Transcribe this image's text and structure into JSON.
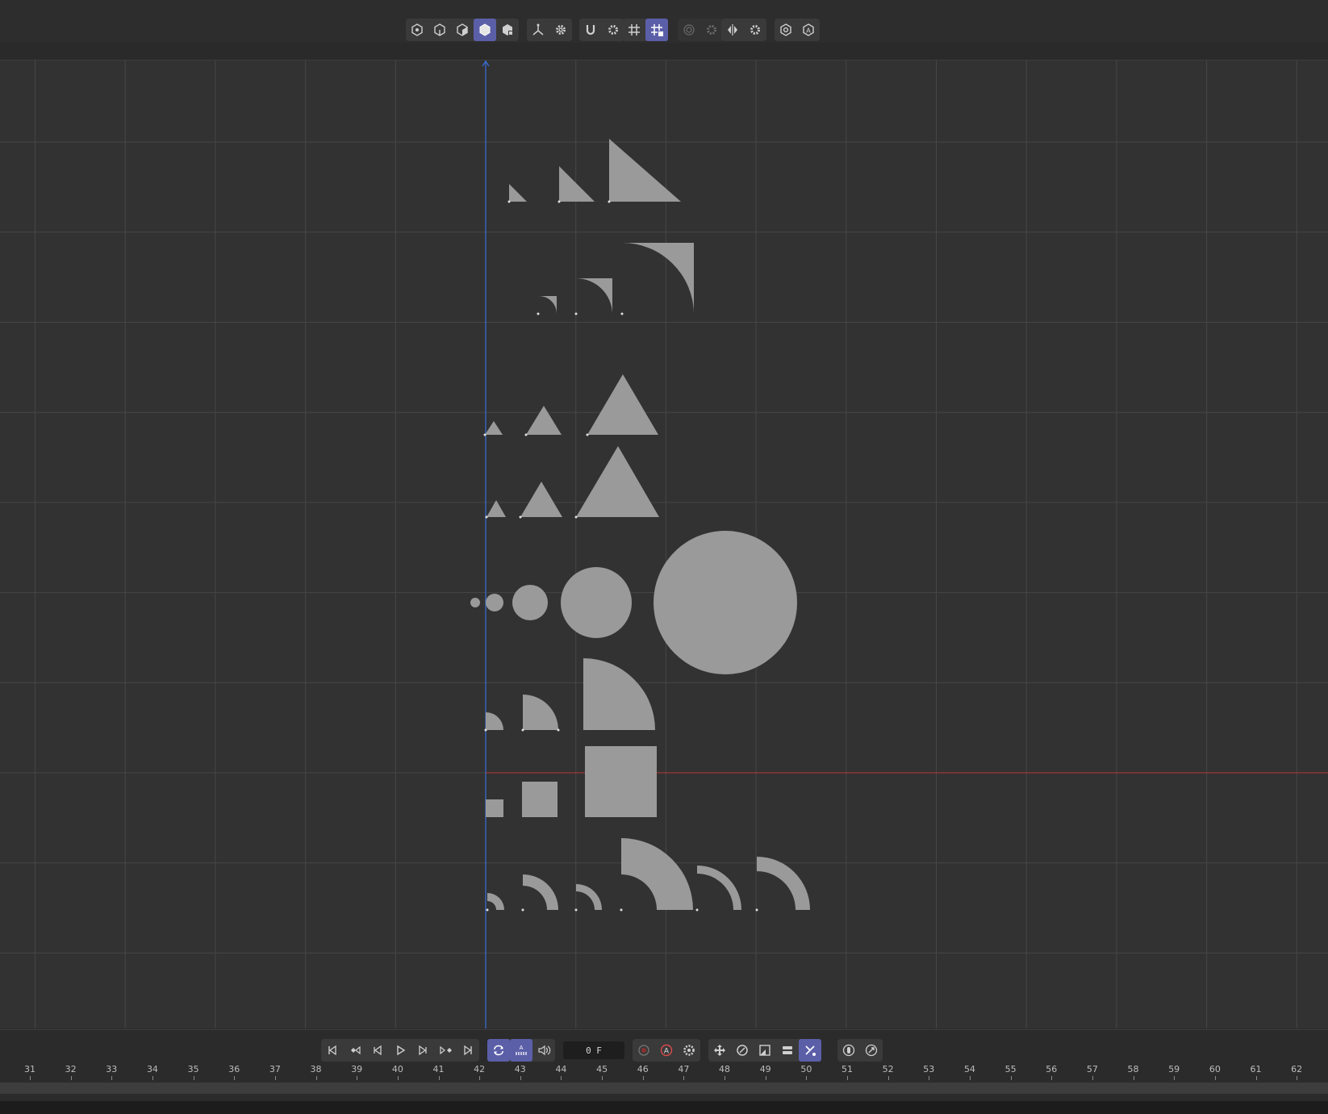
{
  "toolbar": {
    "groups": [
      {
        "name": "view-mode-group",
        "buttons": [
          {
            "icon": "points-mode-icon",
            "active": false
          },
          {
            "icon": "edges-mode-icon",
            "active": false
          },
          {
            "icon": "polygons-mode-icon",
            "active": false
          },
          {
            "icon": "model-mode-icon",
            "active": true
          },
          {
            "icon": "texture-mode-icon",
            "active": false
          }
        ]
      },
      {
        "name": "axis-group",
        "buttons": [
          {
            "icon": "axis-icon",
            "active": false
          },
          {
            "icon": "gear-icon",
            "active": false
          }
        ]
      },
      {
        "name": "snap-group",
        "buttons": [
          {
            "icon": "magnet-icon",
            "active": false
          },
          {
            "icon": "gear-icon",
            "active": false
          }
        ]
      },
      {
        "name": "grid-group",
        "buttons": [
          {
            "icon": "grid-icon",
            "active": false
          },
          {
            "icon": "grid-lock-icon",
            "active": true
          }
        ]
      },
      {
        "name": "soft-select-group",
        "buttons": [
          {
            "icon": "soft-selection-icon",
            "active": false
          },
          {
            "icon": "gear-icon",
            "active": false
          }
        ]
      },
      {
        "name": "symmetry-group",
        "buttons": [
          {
            "icon": "symmetry-icon",
            "active": false
          },
          {
            "icon": "gear-icon",
            "active": false
          }
        ]
      },
      {
        "name": "render-group",
        "buttons": [
          {
            "icon": "render-view-icon",
            "active": false
          },
          {
            "icon": "auto-key-icon",
            "active": false
          }
        ]
      }
    ]
  },
  "timeline": {
    "current_frame": "0 F",
    "ruler_labels": [
      "31",
      "32",
      "33",
      "34",
      "35",
      "36",
      "37",
      "38",
      "39",
      "40",
      "41",
      "42",
      "43",
      "44",
      "45",
      "46",
      "47",
      "48",
      "49",
      "50",
      "51",
      "52",
      "53",
      "54",
      "55",
      "56",
      "57",
      "58",
      "59",
      "60",
      "61",
      "62"
    ],
    "playback_buttons": [
      "go-to-start-icon",
      "previous-key-icon",
      "previous-frame-icon",
      "play-icon",
      "next-frame-icon",
      "next-key-icon",
      "go-to-end-icon"
    ],
    "mode_buttons": [
      "loop-icon",
      "auto-keyframe-icon",
      "sound-icon"
    ],
    "record_buttons": [
      "record-icon",
      "autokey-record-icon",
      "keyframe-settings-icon"
    ],
    "key_buttons": [
      "move-key-icon",
      "rotate-key-icon",
      "scale-key-icon",
      "param-key-icon",
      "point-level-key-icon"
    ],
    "extra_buttons": [
      "motion-record-icon",
      "motion-settings-icon"
    ]
  },
  "colors": {
    "accent": "#5b5fa8",
    "viewport_bg": "#323232",
    "grid_line": "#454545",
    "shape_fill": "#9a9a9a",
    "y_axis": "#3a6fd8",
    "x_axis": "#c23a3a"
  }
}
